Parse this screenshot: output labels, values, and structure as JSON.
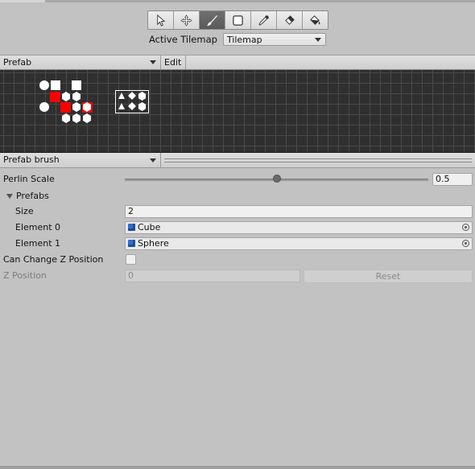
{
  "toolbar": {
    "tools": [
      {
        "name": "select-tool",
        "icon": "cursor-arrow-icon",
        "active": false
      },
      {
        "name": "move-tool",
        "icon": "move-arrows-icon",
        "active": false
      },
      {
        "name": "paint-tool",
        "icon": "paintbrush-icon",
        "active": true
      },
      {
        "name": "box-fill-tool",
        "icon": "rounded-square-icon",
        "active": false
      },
      {
        "name": "picker-tool",
        "icon": "eyedropper-icon",
        "active": false
      },
      {
        "name": "erase-tool",
        "icon": "eraser-icon",
        "active": false
      },
      {
        "name": "fill-tool",
        "icon": "paint-bucket-icon",
        "active": false
      }
    ]
  },
  "active_tilemap": {
    "label": "Active Tilemap",
    "value": "Tilemap"
  },
  "palette": {
    "selected": "Prefab",
    "edit_label": "Edit"
  },
  "brush": {
    "selected": "Prefab brush"
  },
  "inspector": {
    "perlin_scale": {
      "label": "Perlin Scale",
      "value": "0.5",
      "fraction": 0.5
    },
    "prefabs": {
      "label": "Prefabs",
      "size_label": "Size",
      "size_value": "2",
      "elements": [
        {
          "label": "Element 0",
          "value": "Cube"
        },
        {
          "label": "Element 1",
          "value": "Sphere"
        }
      ]
    },
    "can_change_z": {
      "label": "Can Change Z Position",
      "checked": false
    },
    "z_position": {
      "label": "Z Position",
      "value": "0",
      "reset_label": "Reset"
    }
  },
  "colors": {
    "grid_bg": "#2f2f2f",
    "highlight_red": "#ff0000",
    "object_icon_blue": "#2e6fcf"
  }
}
